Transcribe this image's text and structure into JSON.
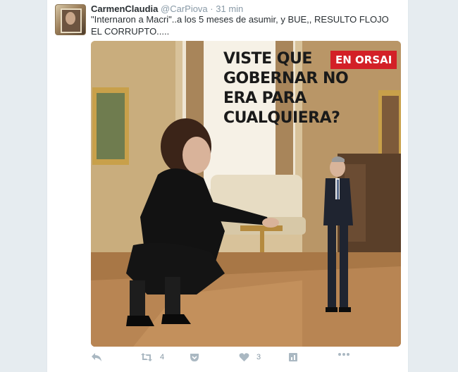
{
  "tweet": {
    "author_name": "CarmenClaudia",
    "author_handle": "@CarPiova",
    "separator": "·",
    "time": "31 min",
    "text": "\"Internaron a Macri\"..a los 5 meses de asumir, y BUE,, RESULTO FLOJO EL CORRUPTO.....",
    "image": {
      "caption": "VISTE QUE GOBERNAR NO ERA PARA CUALQUIERA?",
      "brand": "EN ORSAI"
    },
    "actions": {
      "retweet_count": "4",
      "like_count": "3"
    },
    "icons": [
      "reply-icon",
      "retweet-icon",
      "pocket-icon",
      "heart-icon",
      "analytics-icon",
      "more-icon"
    ],
    "colors": {
      "brand_red": "#d32027",
      "icon_gray": "#aab8c2"
    }
  }
}
